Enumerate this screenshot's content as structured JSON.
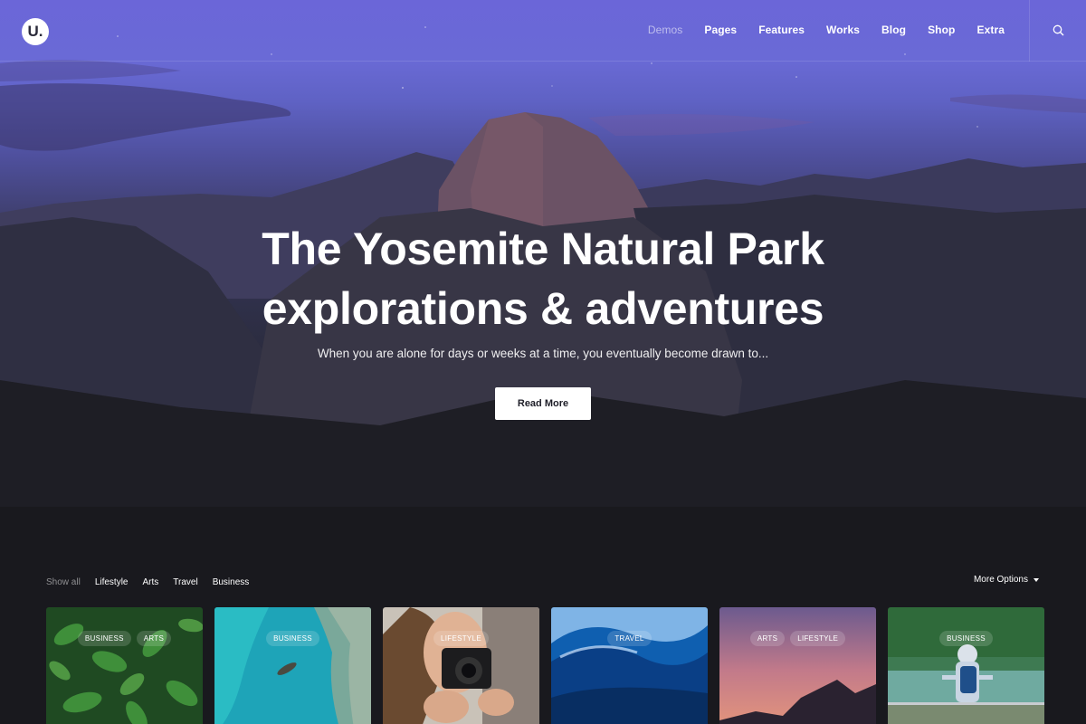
{
  "logo": {
    "letter": "U."
  },
  "nav": {
    "items": [
      {
        "label": "Demos",
        "active": true
      },
      {
        "label": "Pages",
        "active": false
      },
      {
        "label": "Features",
        "active": false
      },
      {
        "label": "Works",
        "active": false
      },
      {
        "label": "Blog",
        "active": false
      },
      {
        "label": "Shop",
        "active": false
      },
      {
        "label": "Extra",
        "active": false
      }
    ],
    "search_icon": "search-icon"
  },
  "hero": {
    "title_line1": "The Yosemite Natural Park",
    "title_line2": "explorations & adventures",
    "subtitle": "When you are alone for days or weeks at a time, you eventually become drawn to...",
    "button": "Read More"
  },
  "filters": {
    "items": [
      "Show all",
      "Lifestyle",
      "Arts",
      "Travel",
      "Business"
    ],
    "more_options": "More Options"
  },
  "cards": [
    {
      "tags": [
        "BUSINESS",
        "ARTS"
      ],
      "image": "green-leaves"
    },
    {
      "tags": [
        "BUSINESS"
      ],
      "image": "turquoise-coast-boat"
    },
    {
      "tags": [
        "LIFESTYLE"
      ],
      "image": "woman-with-camera"
    },
    {
      "tags": [
        "TRAVEL"
      ],
      "image": "ocean-wave"
    },
    {
      "tags": [
        "ARTS",
        "LIFESTYLE"
      ],
      "image": "sunset-mountains"
    },
    {
      "tags": [
        "BUSINESS"
      ],
      "image": "hiker-at-lake"
    }
  ],
  "colors": {
    "accent": "#6b66d8",
    "background": "#16161d",
    "button_bg": "#ffffff"
  }
}
